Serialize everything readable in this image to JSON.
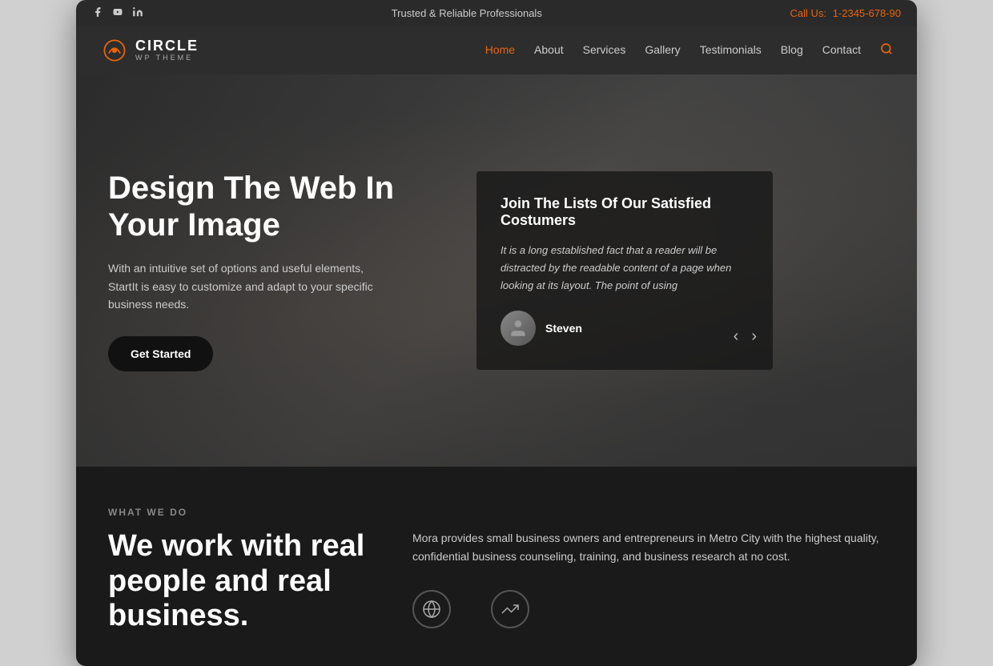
{
  "topbar": {
    "tagline": "Trusted & Reliable Professionals",
    "call_us_label": "Call Us:",
    "phone": "1-2345-678-90",
    "social": [
      {
        "name": "facebook",
        "symbol": "f"
      },
      {
        "name": "youtube",
        "symbol": "▶"
      },
      {
        "name": "linkedin",
        "symbol": "in"
      }
    ]
  },
  "navbar": {
    "logo_circle": "CIRCLE",
    "logo_sub": "WP THEME",
    "nav_items": [
      {
        "label": "Home",
        "active": true
      },
      {
        "label": "About",
        "active": false
      },
      {
        "label": "Services",
        "active": false
      },
      {
        "label": "Gallery",
        "active": false
      },
      {
        "label": "Testimonials",
        "active": false
      },
      {
        "label": "Blog",
        "active": false
      },
      {
        "label": "Contact",
        "active": false
      }
    ]
  },
  "hero": {
    "title": "Design The Web In Your Image",
    "subtitle": "With an intuitive set of options and useful elements, StartIt is easy to customize and adapt to your specific business needs.",
    "cta_button": "Get Started",
    "testimonial": {
      "heading": "Join The Lists Of Our Satisfied Costumers",
      "text": "It is a long established fact that a reader will be distracted by the readable content of a page when looking at its layout. The point of using",
      "author_name": "Steven"
    }
  },
  "bottom": {
    "section_label": "WHAT WE DO",
    "heading_line1": "We work with real",
    "heading_line2": "people and real",
    "heading_line3": "business.",
    "description": "Mora provides small business owners and entrepreneurs in Metro City with the highest quality, confidential business counseling, training, and business research at no cost.",
    "icons": [
      {
        "name": "globe-icon",
        "symbol": "🌐"
      },
      {
        "name": "chart-icon",
        "symbol": "📈"
      }
    ]
  }
}
